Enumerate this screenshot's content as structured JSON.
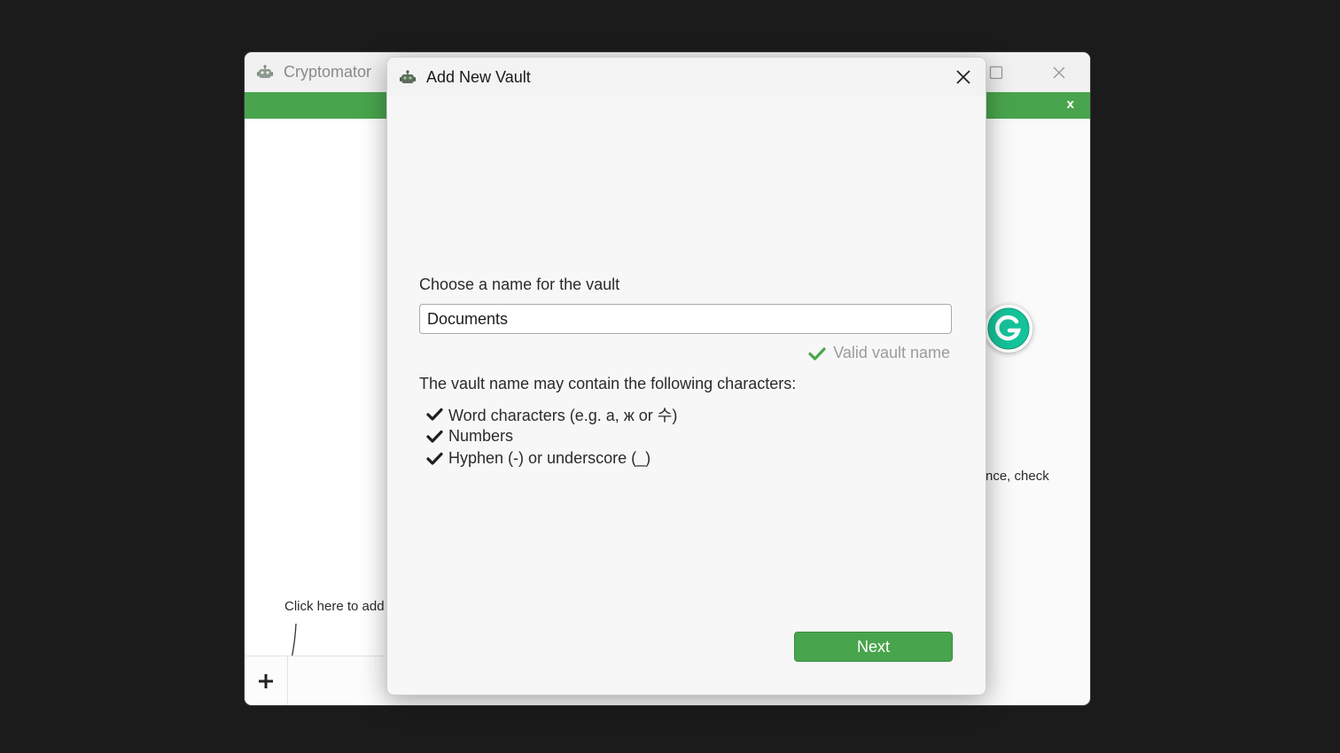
{
  "main_window": {
    "title": "Cryptomator",
    "greenbar_close": "x",
    "sidebar_hint": "Click here to add",
    "right_fragment": "nce, check"
  },
  "dialog": {
    "title": "Add New Vault",
    "name_label": "Choose a name for the vault",
    "name_value": "Documents",
    "validation": "Valid vault name",
    "rules_intro": "The vault name may contain the following characters:",
    "rules": [
      "Word characters (e.g. a, ж or 수)",
      "Numbers",
      "Hyphen (-) or underscore (_)"
    ],
    "next_label": "Next"
  },
  "icons": {
    "app_logo": "cryptomator-robot-icon",
    "close": "close-icon",
    "maximize": "maximize-icon",
    "add": "plus-icon",
    "check": "check-icon",
    "grammarly": "grammarly-icon"
  },
  "colors": {
    "accent_green": "#49a54d",
    "grammarly_green": "#15c39a"
  }
}
